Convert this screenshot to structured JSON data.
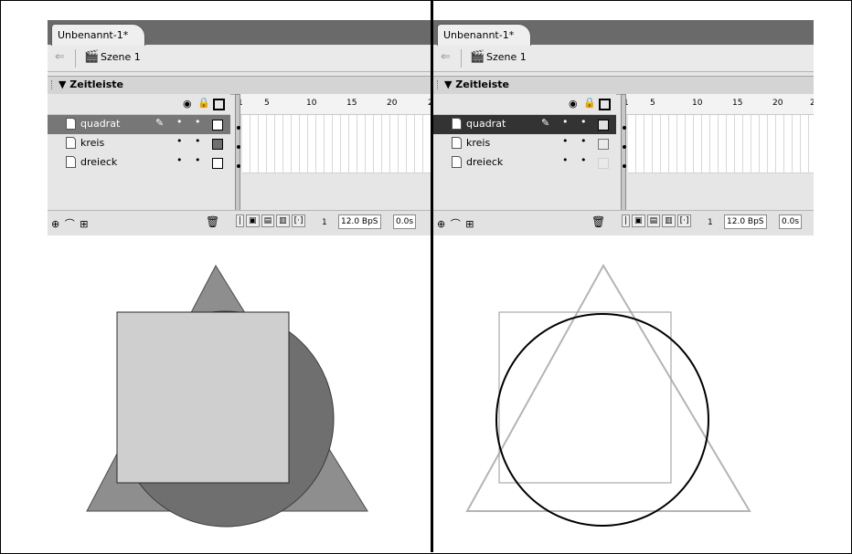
{
  "left": {
    "tab": "Unbenannt-1*",
    "scene": "Szene 1",
    "timeline_title": "▼ Zeitleiste",
    "ticks": [
      "1",
      "5",
      "10",
      "15",
      "20",
      "2"
    ],
    "layers": [
      {
        "name": "quadrat",
        "selected": true,
        "swatch": "#ffffff"
      },
      {
        "name": "kreis",
        "selected": false,
        "swatch": "#6f6f6f"
      },
      {
        "name": "dreieck",
        "selected": false,
        "swatch": "#ffffff"
      }
    ],
    "frame": "1",
    "fps": "12.0 BpS",
    "time": "0.0s"
  },
  "right": {
    "tab": "Unbenannt-1*",
    "scene": "Szene 1",
    "timeline_title": "▼ Zeitleiste",
    "ticks": [
      "1",
      "5",
      "10",
      "15",
      "20",
      "2"
    ],
    "layers": [
      {
        "name": "quadrat",
        "selected": true,
        "swatch": "#e0e0e0"
      },
      {
        "name": "kreis",
        "selected": false,
        "swatch": "#eaeaea"
      },
      {
        "name": "dreieck",
        "selected": false,
        "swatch": "#eaeaea"
      }
    ],
    "frame": "1",
    "fps": "12.0 BpS",
    "time": "0.0s"
  },
  "icons": {
    "back": "arrow-left-icon",
    "scene": "clapperboard-icon",
    "eye": "eye-icon",
    "lock": "lock-icon",
    "outline": "outline-square-icon",
    "pencil": "pencil-icon",
    "trash": "trash-icon"
  },
  "colors": {
    "triangle_fill": "#8e8e8e",
    "circle_fill": "#6f6f6f",
    "square_fill": "#cfcfcf",
    "outline_gray": "#b4b4b4",
    "outline_dark": "#000000"
  }
}
